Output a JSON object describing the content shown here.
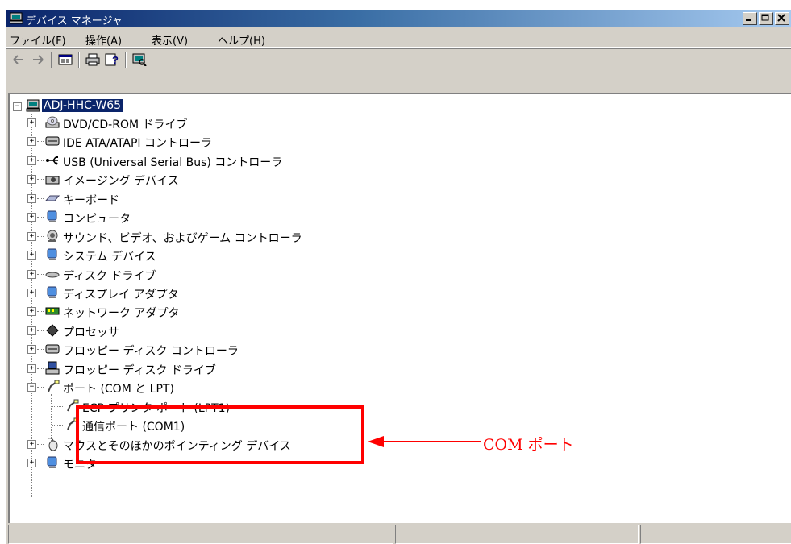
{
  "window": {
    "title": "デバイス マネージャ",
    "buttons": [
      "minimize-icon",
      "maximize-icon",
      "close-icon"
    ]
  },
  "menu": [
    {
      "label": "ファイル(F)"
    },
    {
      "label": "操作(A)"
    },
    {
      "label": "表示(V)"
    },
    {
      "label": "ヘルプ(H)"
    }
  ],
  "toolbar": {
    "icons": [
      "back-arrow-icon",
      "forward-arrow-icon",
      "properties-icon",
      "print-icon",
      "help-icon",
      "scan-hardware-icon"
    ]
  },
  "tree": {
    "root": {
      "label": "ADJ-HHC-W65",
      "expanded": true,
      "selected": true,
      "icon": "computer-icon"
    },
    "items": [
      {
        "label": "DVD/CD-ROM ドライブ",
        "icon": "dvd-drive-icon"
      },
      {
        "label": "IDE ATA/ATAPI コントローラ",
        "icon": "ide-controller-icon"
      },
      {
        "label": "USB (Universal Serial Bus) コントローラ",
        "icon": "usb-icon"
      },
      {
        "label": "イメージング デバイス",
        "icon": "camera-icon"
      },
      {
        "label": "キーボード",
        "icon": "keyboard-icon"
      },
      {
        "label": "コンピュータ",
        "icon": "monitor-icon"
      },
      {
        "label": "サウンド、ビデオ、およびゲーム コントローラ",
        "icon": "speaker-icon"
      },
      {
        "label": "システム デバイス",
        "icon": "system-device-icon"
      },
      {
        "label": "ディスク ドライブ",
        "icon": "disk-drive-icon"
      },
      {
        "label": "ディスプレイ アダプタ",
        "icon": "display-adapter-icon"
      },
      {
        "label": "ネットワーク アダプタ",
        "icon": "network-card-icon"
      },
      {
        "label": "プロセッサ",
        "icon": "processor-icon"
      },
      {
        "label": "フロッピー ディスク コントローラ",
        "icon": "floppy-controller-icon"
      },
      {
        "label": "フロッピー ディスク ドライブ",
        "icon": "floppy-drive-icon"
      },
      {
        "label": "ポート (COM と LPT)",
        "icon": "port-icon",
        "expanded": true
      },
      {
        "label": "ECP プリンタ ポート (LPT1)",
        "icon": "port-icon",
        "child": true
      },
      {
        "label": "通信ポート (COM1)",
        "icon": "port-icon",
        "child": true
      },
      {
        "label": "マウスとそのほかのポインティング デバイス",
        "icon": "mouse-icon"
      },
      {
        "label": "モニタ",
        "icon": "monitor-icon"
      }
    ]
  },
  "annotation": {
    "text": "COM ポート",
    "color": "#ff0000"
  },
  "colors": {
    "titlebar_start": "#0a246a",
    "titlebar_end": "#a6caf0",
    "selection": "#0a246a",
    "face": "#d4d0c8"
  }
}
